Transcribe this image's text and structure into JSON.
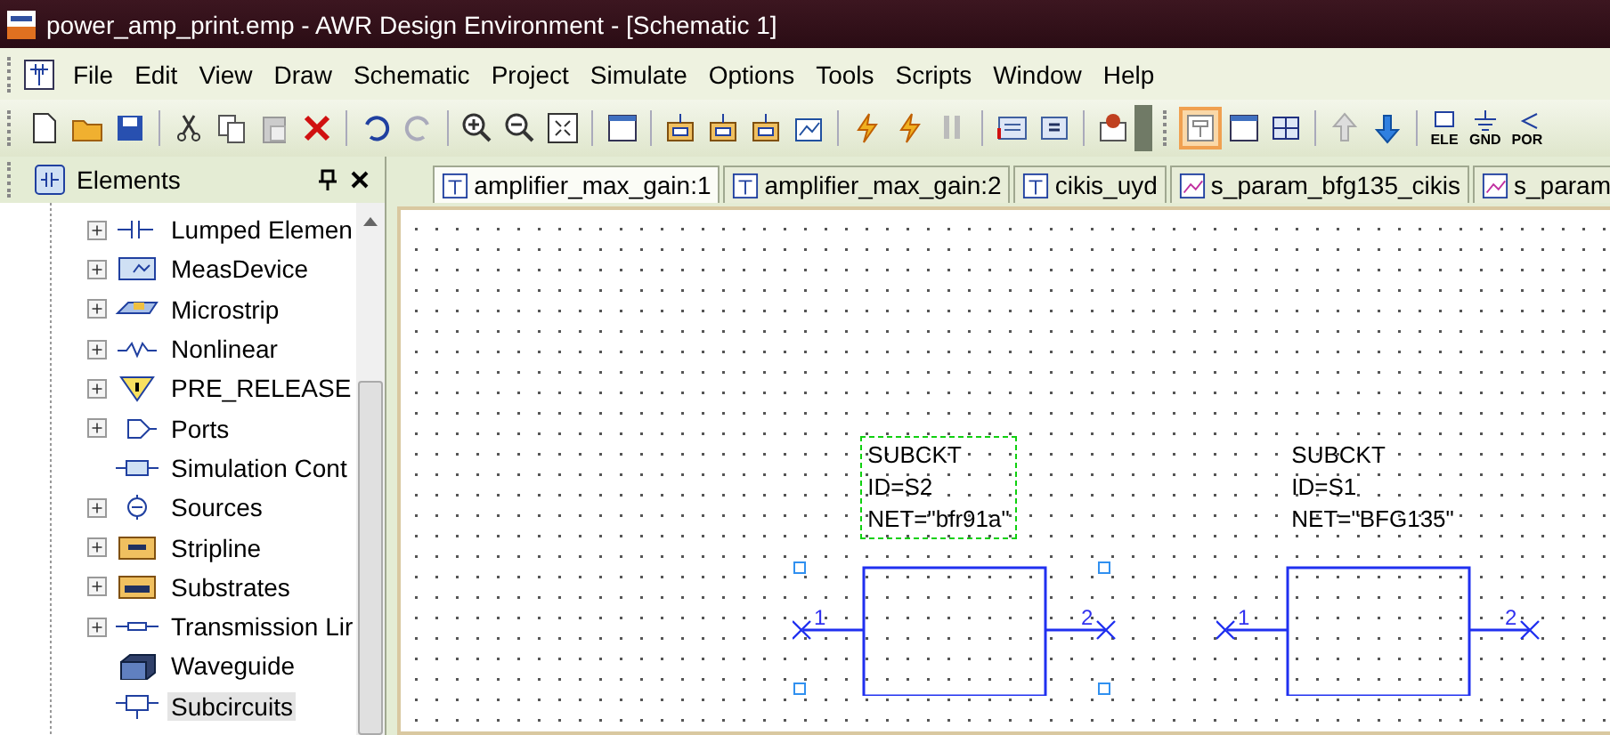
{
  "window": {
    "title": "power_amp_print.emp - AWR Design Environment - [Schematic 1]"
  },
  "menu": [
    "File",
    "Edit",
    "View",
    "Draw",
    "Schematic",
    "Project",
    "Simulate",
    "Options",
    "Tools",
    "Scripts",
    "Window",
    "Help"
  ],
  "toolbar": {
    "labels": [
      "ELE",
      "GND",
      "POR"
    ]
  },
  "elements_panel": {
    "title": "Elements",
    "items": [
      {
        "label": "Lumped Elemen",
        "expandable": true,
        "selected": false
      },
      {
        "label": "MeasDevice",
        "expandable": true,
        "selected": false
      },
      {
        "label": "Microstrip",
        "expandable": true,
        "selected": false
      },
      {
        "label": "Nonlinear",
        "expandable": true,
        "selected": false
      },
      {
        "label": "PRE_RELEASE",
        "expandable": true,
        "selected": false
      },
      {
        "label": "Ports",
        "expandable": true,
        "selected": false
      },
      {
        "label": "Simulation Cont",
        "expandable": false,
        "selected": false
      },
      {
        "label": "Sources",
        "expandable": true,
        "selected": false
      },
      {
        "label": "Stripline",
        "expandable": true,
        "selected": false
      },
      {
        "label": "Substrates",
        "expandable": true,
        "selected": false
      },
      {
        "label": "Transmission Lir",
        "expandable": true,
        "selected": false
      },
      {
        "label": "Waveguide",
        "expandable": false,
        "selected": false
      },
      {
        "label": "Subcircuits",
        "expandable": false,
        "selected": true
      }
    ]
  },
  "tabs": [
    {
      "label": "amplifier_max_gain:1",
      "selected": true
    },
    {
      "label": "amplifier_max_gain:2",
      "selected": false
    },
    {
      "label": "cikis_uyd",
      "selected": false
    },
    {
      "label": "s_param_bfg135_cikis",
      "selected": false
    },
    {
      "label": "s_param",
      "selected": false
    }
  ],
  "schematic": {
    "components": [
      {
        "lines": [
          "SUBCKT",
          "ID=S2",
          "NET=\"bfr91a\""
        ],
        "pins": [
          "1",
          "2"
        ],
        "selected": true
      },
      {
        "lines": [
          "SUBCKT",
          "ID=S1",
          "NET=\"BFG135\""
        ],
        "pins": [
          "1",
          "2"
        ],
        "selected": false
      }
    ]
  }
}
